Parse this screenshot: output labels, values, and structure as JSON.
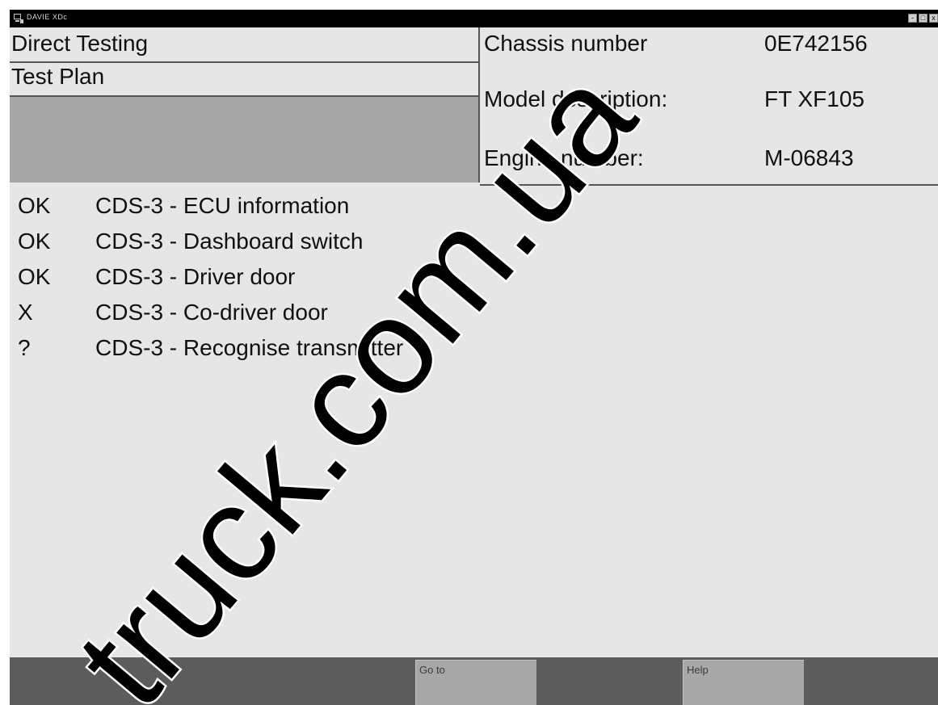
{
  "window": {
    "title": "DAVIE XDc",
    "controls": {
      "minimize": "-",
      "maximize": "□",
      "close": "x"
    }
  },
  "header": {
    "menu": {
      "direct_testing": "Direct Testing",
      "test_plan": "Test Plan"
    },
    "vehicle": {
      "chassis_label": "Chassis number",
      "chassis_value": "0E742156",
      "model_label": "Model description:",
      "model_value": "FT XF105",
      "engine_label": "Engine number:",
      "engine_value": "M-06843"
    }
  },
  "tests": [
    {
      "status": "OK",
      "name": "CDS-3 - ECU information"
    },
    {
      "status": "OK",
      "name": "CDS-3 - Dashboard switch"
    },
    {
      "status": "OK",
      "name": "CDS-3 - Driver door"
    },
    {
      "status": "X",
      "name": "CDS-3 - Co-driver door"
    },
    {
      "status": "?",
      "name": "CDS-3 - Recognise transmitter"
    }
  ],
  "footer": {
    "goto_label": "Go to",
    "help_label": "Help"
  },
  "watermark": {
    "text": "truck.com.ua"
  },
  "colors": {
    "background": "#e6e6e6",
    "titlebar": "#000000",
    "highlight_row": "#a6a6a6",
    "footer": "#5c5c5c",
    "button": "#a8a8a8"
  }
}
